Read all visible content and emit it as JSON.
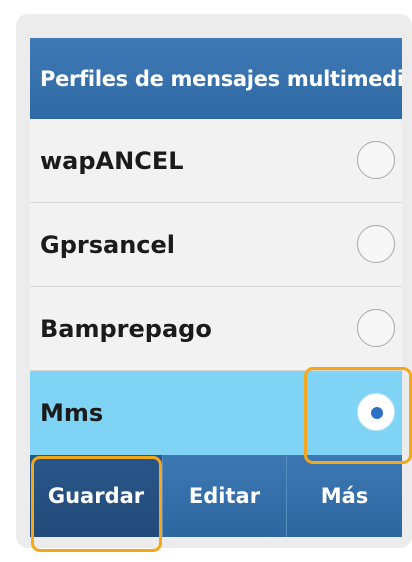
{
  "header": {
    "title": "Perfiles de mensajes multimedia"
  },
  "profiles": [
    {
      "label": "wapANCEL",
      "selected": false
    },
    {
      "label": "Gprsancel",
      "selected": false
    },
    {
      "label": "Bamprepago",
      "selected": false
    },
    {
      "label": "Mms",
      "selected": true
    }
  ],
  "softkeys": {
    "left": "Guardar",
    "center": "Editar",
    "right": "Más"
  },
  "colors": {
    "header": "#2f69a4",
    "selected_row": "#7fd3f5",
    "row": "#f2f2f2",
    "radio_dot": "#2f6fc4",
    "highlight": "#f3a81b"
  }
}
